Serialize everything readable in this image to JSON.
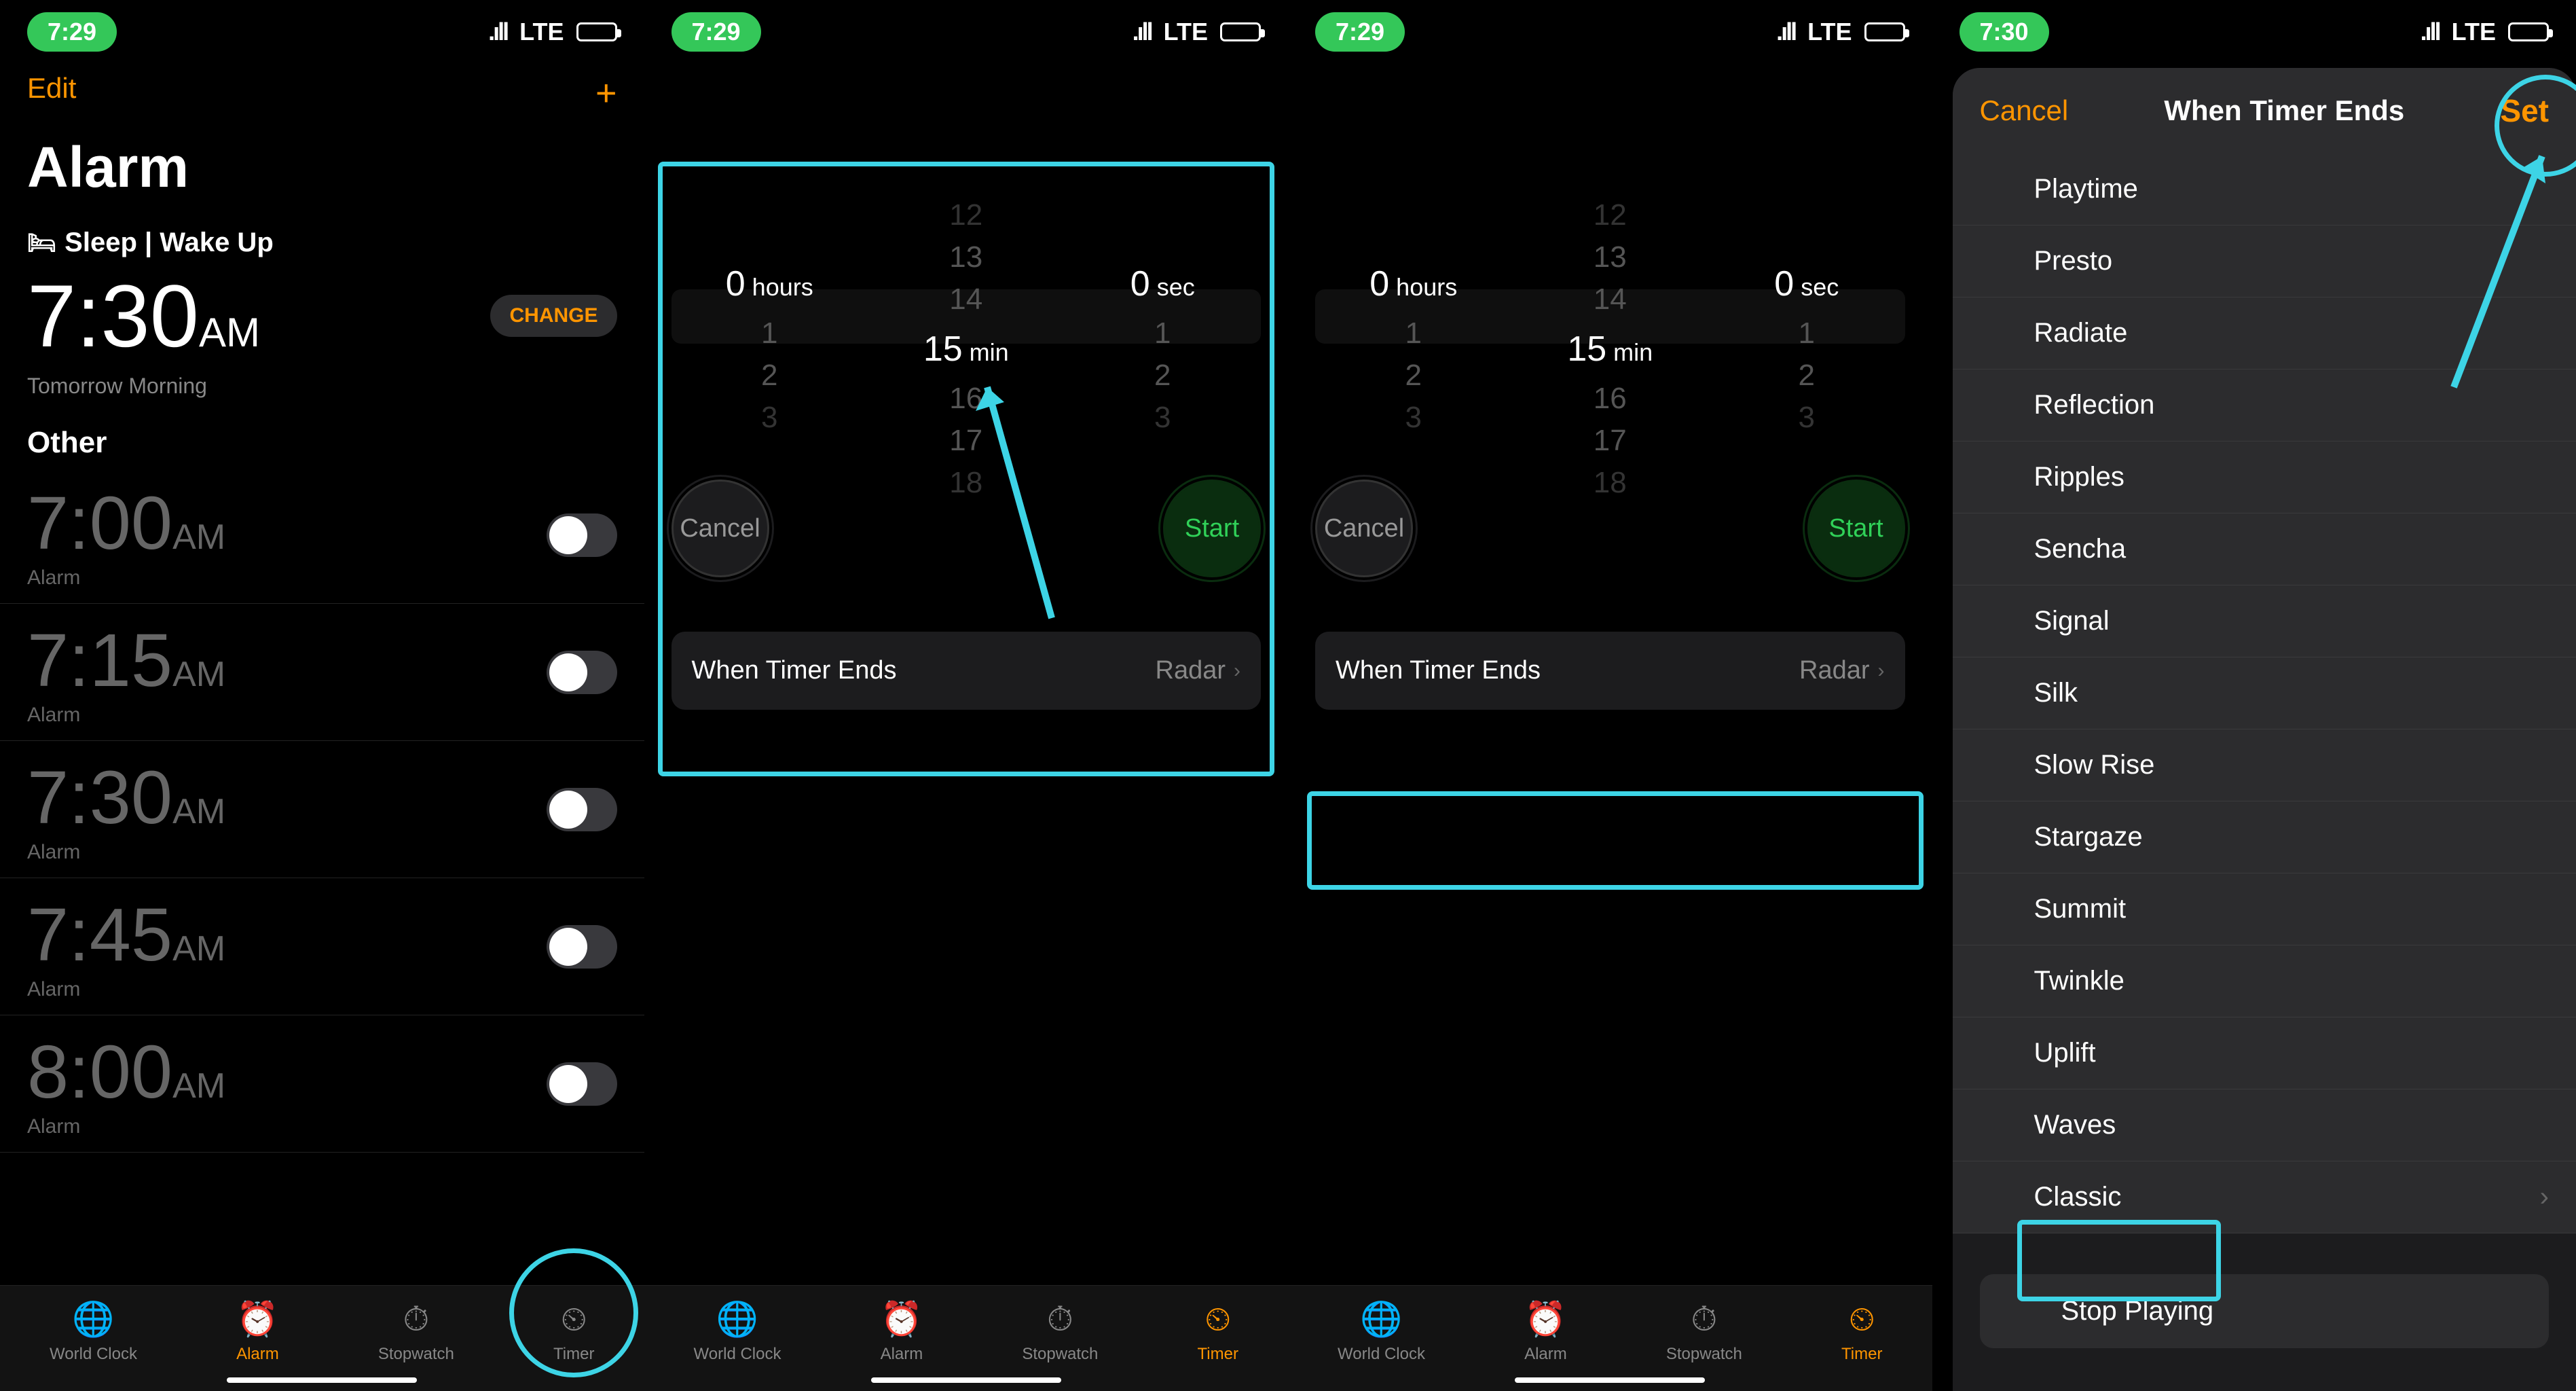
{
  "status": {
    "time1": "7:29",
    "time4": "7:30",
    "network": "LTE",
    "signal": ".ıll"
  },
  "alarm": {
    "edit": "Edit",
    "title": "Alarm",
    "sleep_label": "Sleep | Wake Up",
    "wake_time": "7:30",
    "wake_ampm": "AM",
    "wake_sub": "Tomorrow Morning",
    "change": "CHANGE",
    "other_label": "Other",
    "alarms": [
      {
        "time": "7:00",
        "ampm": "AM",
        "label": "Alarm"
      },
      {
        "time": "7:15",
        "ampm": "AM",
        "label": "Alarm"
      },
      {
        "time": "7:30",
        "ampm": "AM",
        "label": "Alarm"
      },
      {
        "time": "7:45",
        "ampm": "AM",
        "label": "Alarm"
      },
      {
        "time": "8:00",
        "ampm": "AM",
        "label": "Alarm"
      }
    ]
  },
  "timer": {
    "hours_val": "0",
    "hours_unit": "hours",
    "min_val": "15",
    "min_unit": "min",
    "sec_val": "0",
    "sec_unit": "sec",
    "min_fade_above": [
      "12",
      "13",
      "14"
    ],
    "min_fade_below": [
      "16",
      "17",
      "18"
    ],
    "hr_fade_below": [
      "1",
      "2",
      "3"
    ],
    "sec_fade_below": [
      "1",
      "2",
      "3"
    ],
    "cancel": "Cancel",
    "start": "Start",
    "when_ends_label": "When Timer Ends",
    "when_ends_value": "Radar"
  },
  "tabs": {
    "world_clock": "World Clock",
    "alarm": "Alarm",
    "stopwatch": "Stopwatch",
    "timer": "Timer"
  },
  "ends_modal": {
    "cancel": "Cancel",
    "title": "When Timer Ends",
    "set": "Set",
    "sounds": [
      "Playtime",
      "Presto",
      "Radiate",
      "Reflection",
      "Ripples",
      "Sencha",
      "Signal",
      "Silk",
      "Slow Rise",
      "Stargaze",
      "Summit",
      "Twinkle",
      "Uplift",
      "Waves",
      "Classic"
    ],
    "stop_playing": "Stop Playing"
  },
  "annotation_color": "#3dd4e6"
}
